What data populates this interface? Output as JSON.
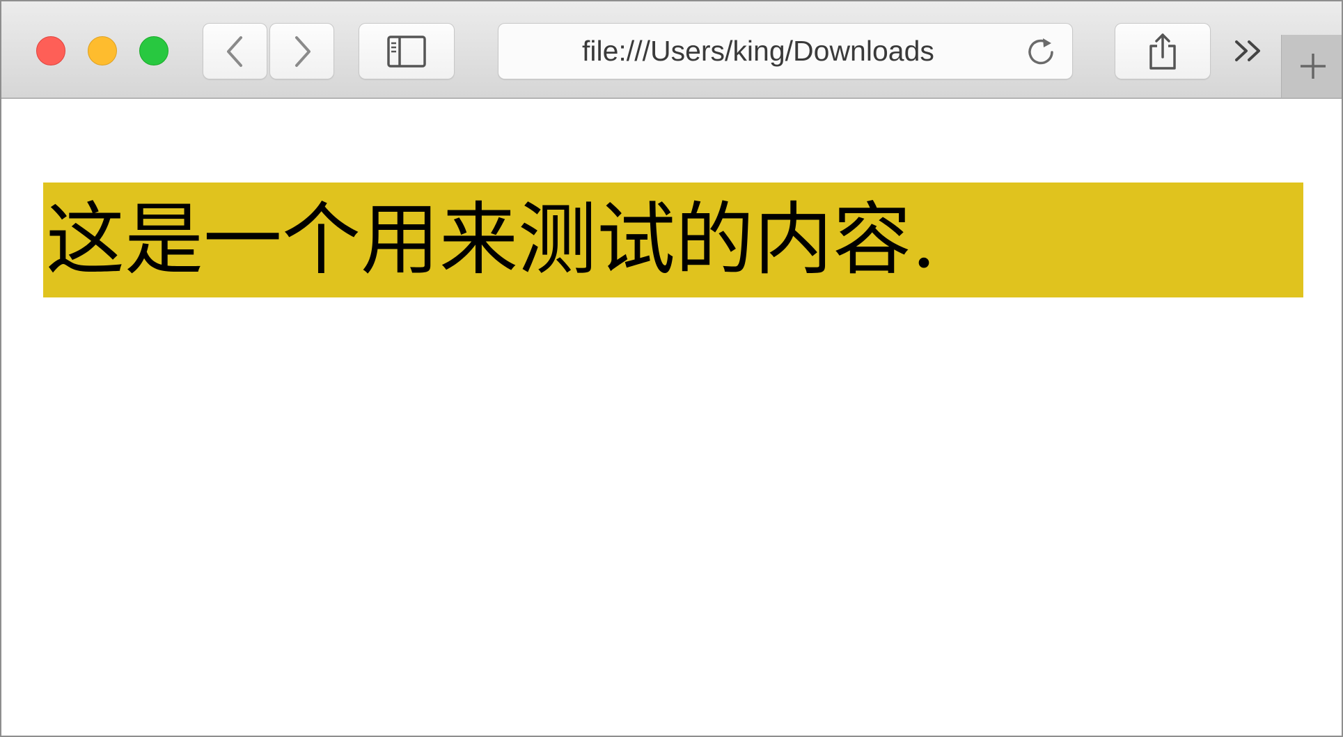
{
  "window": {
    "controls": [
      "close",
      "minimize",
      "maximize"
    ]
  },
  "toolbar": {
    "back_icon": "chevron-left-icon",
    "forward_icon": "chevron-right-icon",
    "sidebar_icon": "sidebar-icon",
    "reload_icon": "reload-icon",
    "share_icon": "share-icon",
    "overflow_icon": "chevron-double-right-icon",
    "new_tab_icon": "plus-icon"
  },
  "address_bar": {
    "url": "file:///Users/king/Downloads"
  },
  "page": {
    "text": "这是一个用来测试的内容.",
    "highlight_color": "#e0c31e"
  },
  "colors": {
    "close": "#fe5f57",
    "minimize": "#febc2e",
    "maximize": "#28c840"
  }
}
